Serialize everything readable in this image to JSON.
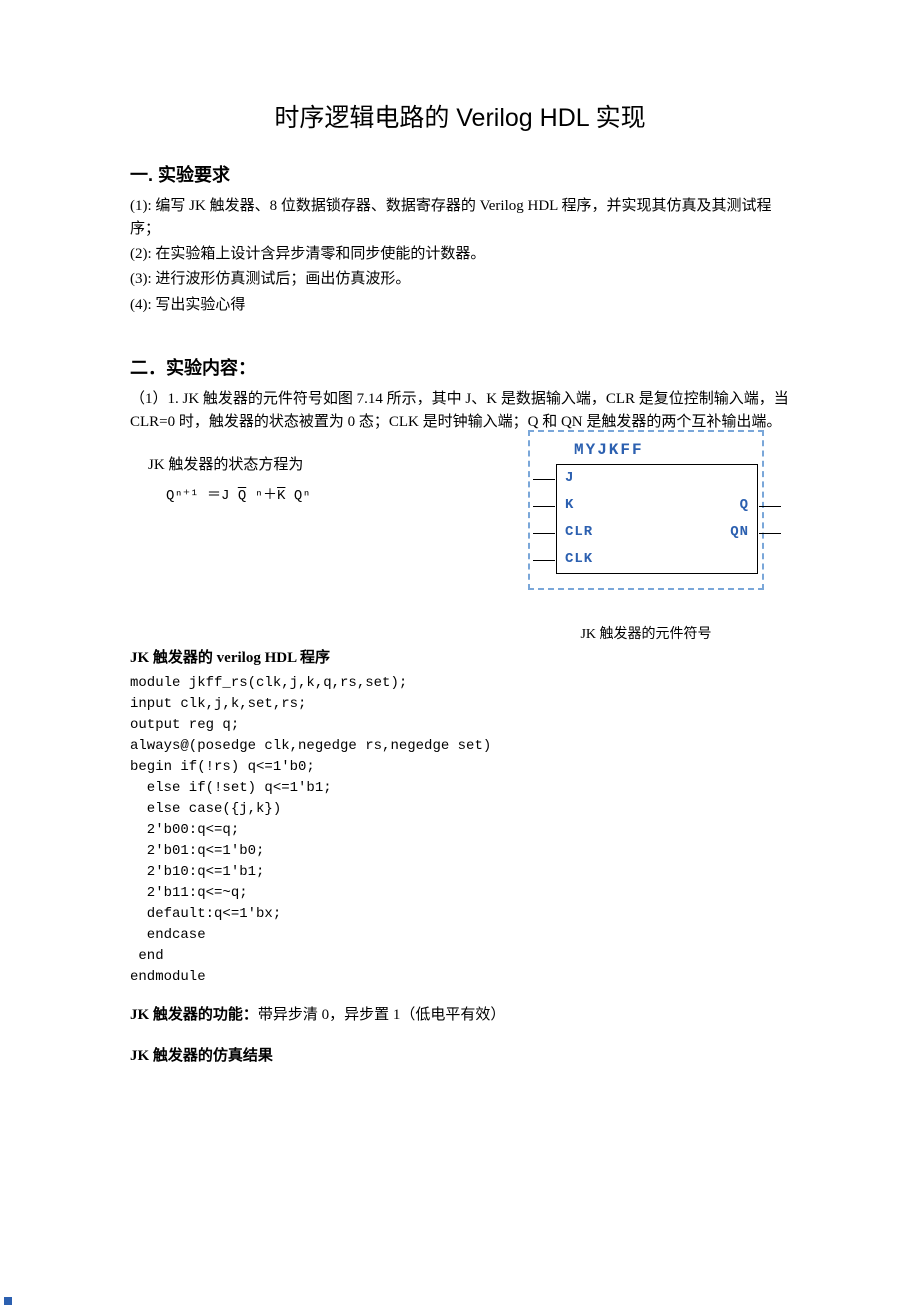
{
  "title": "时序逻辑电路的 Verilog HDL 实现",
  "sec1_heading": "一. 实验要求",
  "sec1_items": {
    "i1": "(1): 编写 JK 触发器、8 位数据锁存器、数据寄存器的 Verilog HDL 程序，并实现其仿真及其测试程序；",
    "i2": "(2): 在实验箱上设计含异步清零和同步使能的计数器。",
    "i3": "(3): 进行波形仿真测试后；画出仿真波形。",
    "i4": "(4): 写出实验心得"
  },
  "sec2_heading": "二．实验内容：",
  "sec2_intro": "（1）1. JK 触发器的元件符号如图 7.14 所示，其中 J、K 是数据输入端，CLR 是复位控制输入端，当 CLR=0 时，触发器的状态被置为 0 态；CLK 是时钟输入端；Q 和 QN 是触发器的两个互补输出端。",
  "eq_label": "JK 触发器的状态方程为",
  "eq": {
    "pre": "Qⁿ⁺¹  ＝J ",
    "ov1": "Q",
    "mid1": " ⁿ＋",
    "ov2": "K",
    "mid2": " Qⁿ"
  },
  "symbol": {
    "title": "MYJKFF",
    "pins": {
      "j": "J",
      "k": "K",
      "clr": "CLR",
      "clk": "CLK",
      "q": "Q",
      "qn": "QN"
    },
    "caption": "JK 触发器的元件符号"
  },
  "code_heading": "JK 触发器的 verilog HDL 程序",
  "code_lines": [
    "module jkff_rs(clk,j,k,q,rs,set);",
    "input clk,j,k,set,rs;",
    "output reg q;",
    "always@(posedge clk,negedge rs,negedge set)",
    "begin if(!rs) q<=1'b0;",
    "  else if(!set) q<=1'b1;",
    "  else case({j,k})",
    "  2'b00:q<=q;",
    "  2'b01:q<=1'b0;",
    "  2'b10:q<=1'b1;",
    "  2'b11:q<=~q;",
    "  default:q<=1'bx;",
    "  endcase",
    " end",
    "endmodule"
  ],
  "func_heading": "JK 触发器的功能：",
  "func_text": "带异步清 0，异步置 1（低电平有效）",
  "sim_heading": "JK 触发器的仿真结果"
}
